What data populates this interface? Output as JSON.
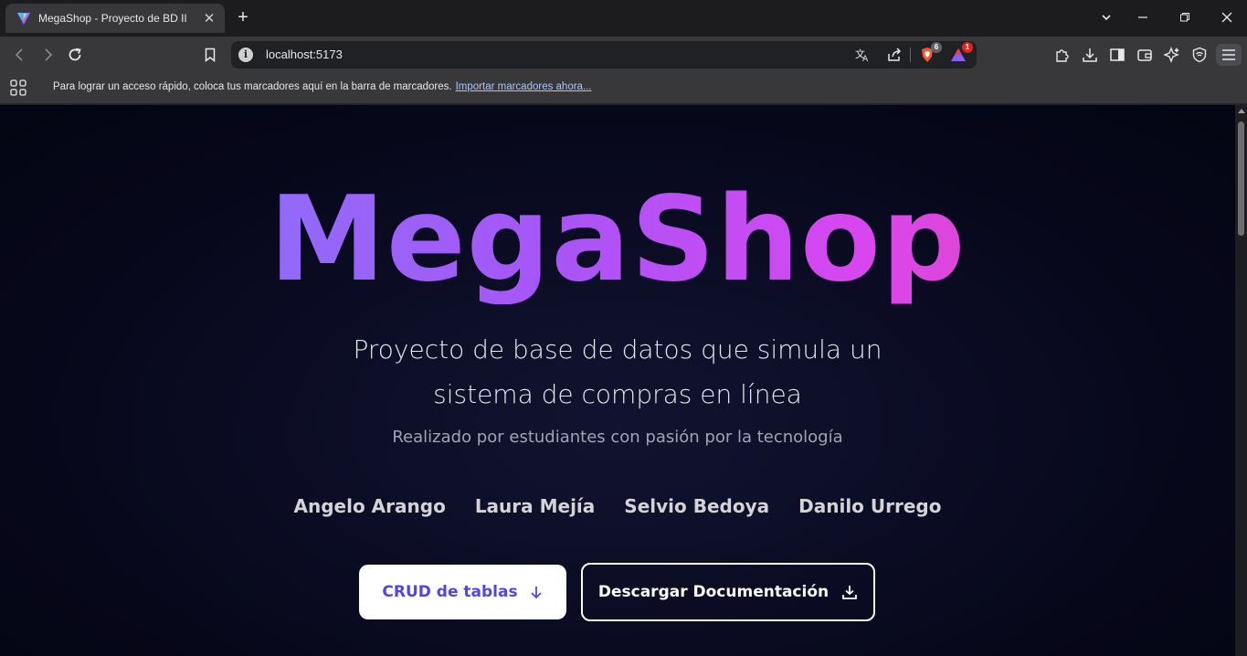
{
  "browser": {
    "tab": {
      "title": "MegaShop - Proyecto de BD II",
      "close_glyph": "✕"
    },
    "new_tab_glyph": "+",
    "window_controls": {
      "dropdown": "⌄",
      "minimize": "—",
      "restore": "❐",
      "close": "✕"
    },
    "address": {
      "url": "localhost:5173",
      "info_glyph": "i"
    },
    "badges": {
      "brave_shields": "6",
      "brave_rewards": "1"
    },
    "bookmarks_bar": {
      "message": "Para lograr un acceso rápido, coloca tus marcadores aquí en la barra de marcadores.",
      "link": "Importar marcadores ahora..."
    }
  },
  "page": {
    "title": "MegaShop",
    "subtitle": "Proyecto de base de datos que simula un sistema de compras en línea",
    "tagline": "Realizado por estudiantes con pasión por la tecnología",
    "authors": [
      "Angelo Arango",
      "Laura Mejía",
      "Selvio Bedoya",
      "Danilo Urrego"
    ],
    "buttons": {
      "crud": "CRUD de tablas",
      "docs": "Descargar Documentación"
    }
  },
  "colors": {
    "gradient_start": "#7c7ff8",
    "gradient_mid": "#a855f7",
    "gradient_end": "#ec4899",
    "crud_text": "#4f46e5",
    "page_bg": "#07081c"
  }
}
